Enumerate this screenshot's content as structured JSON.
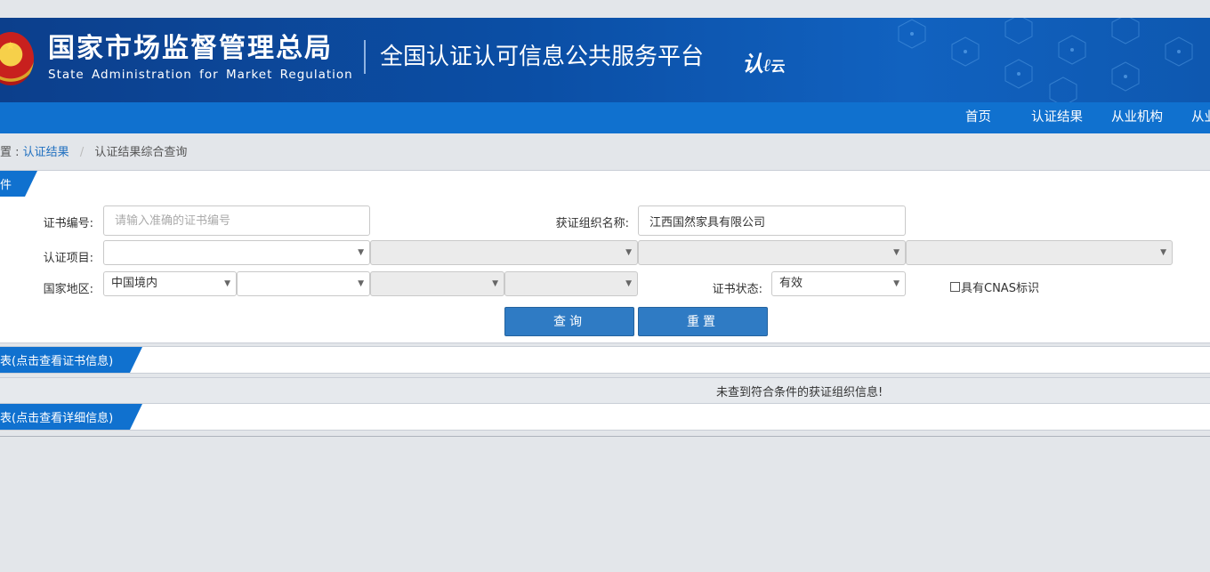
{
  "header": {
    "org_cn": "国家市场监督管理总局",
    "org_en": "State Administration  for  Market Regulation",
    "platform": "全国认证认可信息公共服务平台",
    "logo_text": "认",
    "logo_text2": "云",
    "brand_color": "#0b4fa6"
  },
  "nav": {
    "items": [
      {
        "label": "首页"
      },
      {
        "label": "认证结果"
      },
      {
        "label": "从业机构"
      },
      {
        "label": "从业"
      }
    ]
  },
  "breadcrumb": {
    "prefix": "置 :",
    "link": "认证结果",
    "current": "认证结果综合查询"
  },
  "search_panel": {
    "tab_label": "件",
    "cert_no_label": "证书编号:",
    "cert_no_placeholder": "请输入准确的证书编号",
    "org_name_label": "获证组织名称:",
    "org_name_value": "江西国然家具有限公司",
    "project_label": "认证项目:",
    "region_label": "国家地区:",
    "region_value": "中国境内",
    "status_label": "证书状态:",
    "status_value": "有效",
    "cnas_label": "具有CNAS标识",
    "query_button": "查询",
    "reset_button": "重置"
  },
  "cert_list": {
    "tab_label": "表(点击查看证书信息)"
  },
  "org_list": {
    "empty_message": "未查到符合条件的获证组织信息!",
    "tab_label": "表(点击查看详细信息)"
  }
}
